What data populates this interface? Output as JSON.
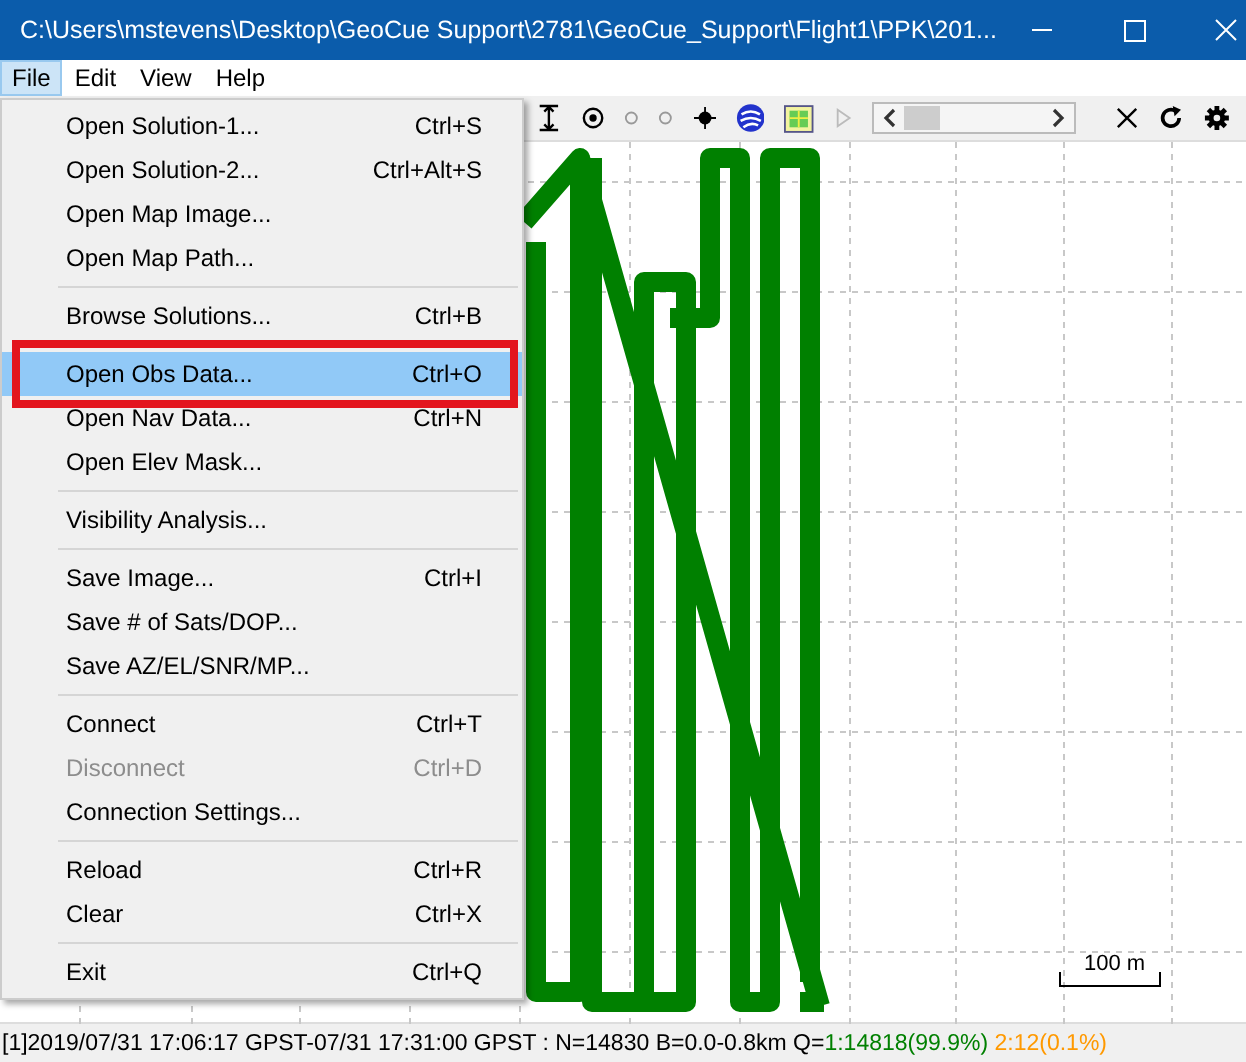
{
  "window": {
    "title": "C:\\Users\\mstevens\\Desktop\\GeoCue Support\\2781\\GeoCue_Support\\Flight1\\PPK\\201..."
  },
  "menu_bar": [
    {
      "label": "File",
      "selected": true
    },
    {
      "label": "Edit",
      "selected": false
    },
    {
      "label": "View",
      "selected": false
    },
    {
      "label": "Help",
      "selected": false
    }
  ],
  "file_menu": [
    {
      "kind": "item",
      "label": "Open Solution-1...",
      "shortcut": "Ctrl+S",
      "selected": false,
      "disabled": false
    },
    {
      "kind": "item",
      "label": "Open Solution-2...",
      "shortcut": "Ctrl+Alt+S",
      "selected": false,
      "disabled": false
    },
    {
      "kind": "item",
      "label": "Open Map Image...",
      "selected": false,
      "disabled": false
    },
    {
      "kind": "item",
      "label": "Open Map Path...",
      "selected": false,
      "disabled": false
    },
    {
      "kind": "separator"
    },
    {
      "kind": "item",
      "label": "Browse Solutions...",
      "shortcut": "Ctrl+B",
      "selected": false,
      "disabled": false
    },
    {
      "kind": "separator"
    },
    {
      "kind": "item",
      "label": "Open Obs Data...",
      "shortcut": "Ctrl+O",
      "selected": true,
      "disabled": false
    },
    {
      "kind": "item",
      "label": "Open Nav Data...",
      "shortcut": "Ctrl+N",
      "selected": false,
      "disabled": false
    },
    {
      "kind": "item",
      "label": "Open Elev Mask...",
      "selected": false,
      "disabled": false
    },
    {
      "kind": "separator"
    },
    {
      "kind": "item",
      "label": "Visibility Analysis...",
      "selected": false,
      "disabled": false
    },
    {
      "kind": "separator"
    },
    {
      "kind": "item",
      "label": "Save Image...",
      "shortcut": "Ctrl+I",
      "selected": false,
      "disabled": false
    },
    {
      "kind": "item",
      "label": "Save # of Sats/DOP...",
      "selected": false,
      "disabled": false
    },
    {
      "kind": "item",
      "label": "Save AZ/EL/SNR/MP...",
      "selected": false,
      "disabled": false
    },
    {
      "kind": "separator"
    },
    {
      "kind": "item",
      "label": "Connect",
      "shortcut": "Ctrl+T",
      "selected": false,
      "disabled": false
    },
    {
      "kind": "item",
      "label": "Disconnect",
      "shortcut": "Ctrl+D",
      "selected": false,
      "disabled": true
    },
    {
      "kind": "item",
      "label": "Connection Settings...",
      "selected": false,
      "disabled": false
    },
    {
      "kind": "separator"
    },
    {
      "kind": "item",
      "label": "Reload",
      "shortcut": "Ctrl+R",
      "selected": false,
      "disabled": false
    },
    {
      "kind": "item",
      "label": "Clear",
      "shortcut": "Ctrl+X",
      "selected": false,
      "disabled": false
    },
    {
      "kind": "separator"
    },
    {
      "kind": "item",
      "label": "Exit",
      "shortcut": "Ctrl+Q",
      "selected": false,
      "disabled": false
    }
  ],
  "plot": {
    "scale_label": "100 m"
  },
  "status_bar": [
    {
      "text": "[1]2019/07/31 17:06:17 GPST-07/31 17:31:00 GPST : N=14830 B=0.0-0.8km Q=",
      "color": "#000000"
    },
    {
      "text": "1:14818(99.9%)",
      "color": "#008000"
    },
    {
      "text": " 2:12(0.1%)",
      "color": "#ff9900"
    }
  ]
}
